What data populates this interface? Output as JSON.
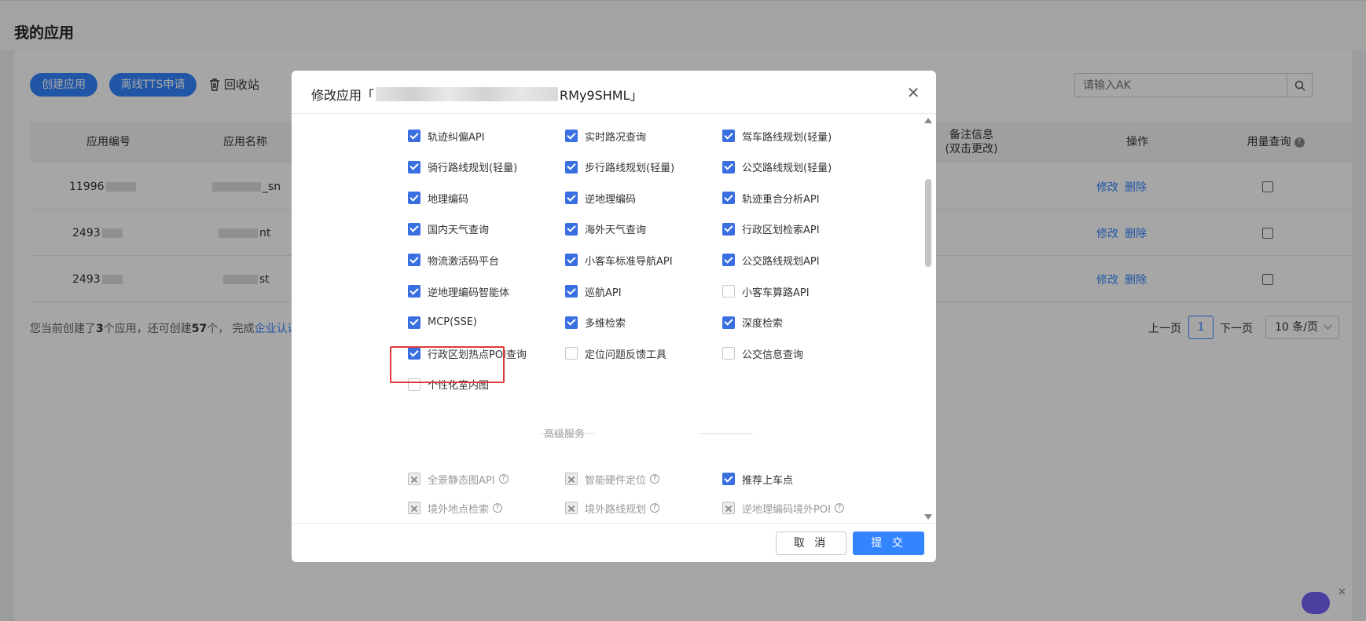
{
  "page": {
    "title": "我的应用"
  },
  "toolbar": {
    "create_label": "创建应用",
    "tts_label": "离线TTS申请",
    "recycle_label": "回收站"
  },
  "search": {
    "placeholder": "请输入AK"
  },
  "table": {
    "headers": {
      "id": "应用编号",
      "name": "应用名称",
      "remark_line1": "备注信息",
      "remark_line2": "(双击更改)",
      "actions": "操作",
      "usage": "用量查询"
    },
    "rows": [
      {
        "id": "11996",
        "name": "_sn",
        "edit": "修改",
        "delete": "删除"
      },
      {
        "id": "2493",
        "name": "nt",
        "edit": "修改",
        "delete": "删除"
      },
      {
        "id": "2493",
        "name": "st",
        "edit": "修改",
        "delete": "删除"
      }
    ]
  },
  "footer": {
    "prefix": "您当前创建了",
    "created": "3",
    "middle": "个应用，还可创建",
    "remaining": "57",
    "suffix": "个，  完成",
    "link": "企业认证"
  },
  "pagination": {
    "prev": "上一页",
    "current": "1",
    "next": "下一页",
    "page_size": "10 条/页"
  },
  "modal": {
    "title_prefix": "修改应用「",
    "title_visible_key": "RMy9SHML」",
    "cancel_label": "取 消",
    "submit_label": "提 交",
    "section_advanced": "高级服务",
    "services": [
      {
        "label": "轨迹纠偏API",
        "state": "checked"
      },
      {
        "label": "实时路况查询",
        "state": "checked"
      },
      {
        "label": "驾车路线规划(轻量)",
        "state": "checked"
      },
      {
        "label": "骑行路线规划(轻量)",
        "state": "checked"
      },
      {
        "label": "步行路线规划(轻量)",
        "state": "checked"
      },
      {
        "label": "公交路线规划(轻量)",
        "state": "checked"
      },
      {
        "label": "地理编码",
        "state": "checked"
      },
      {
        "label": "逆地理编码",
        "state": "checked"
      },
      {
        "label": "轨迹重合分析API",
        "state": "checked"
      },
      {
        "label": "国内天气查询",
        "state": "checked"
      },
      {
        "label": "海外天气查询",
        "state": "checked"
      },
      {
        "label": "行政区划检索API",
        "state": "checked"
      },
      {
        "label": "物流激活码平台",
        "state": "checked"
      },
      {
        "label": "小客车标准导航API",
        "state": "checked"
      },
      {
        "label": "公交路线规划API",
        "state": "checked"
      },
      {
        "label": "逆地理编码智能体",
        "state": "checked"
      },
      {
        "label": "巡航API",
        "state": "checked"
      },
      {
        "label": "小客车算路API",
        "state": "unchecked"
      },
      {
        "label": "MCP(SSE)",
        "state": "checked"
      },
      {
        "label": "多维检索",
        "state": "checked"
      },
      {
        "label": "深度检索",
        "state": "checked"
      },
      {
        "label": "行政区划热点POI查询",
        "state": "checked"
      },
      {
        "label": "定位问题反馈工具",
        "state": "unchecked"
      },
      {
        "label": "公交信息查询",
        "state": "unchecked"
      },
      {
        "label": "个性化室内图",
        "state": "unchecked"
      }
    ],
    "advanced": [
      {
        "label": "全景静态图API",
        "state": "disabled",
        "help": "?"
      },
      {
        "label": "智能硬件定位",
        "state": "disabled",
        "help": "?"
      },
      {
        "label": "推荐上车点",
        "state": "checked",
        "help": ""
      },
      {
        "label": "境外地点检索",
        "state": "disabled",
        "help": "?"
      },
      {
        "label": "境外路线规划",
        "state": "disabled",
        "help": "?"
      },
      {
        "label": "逆地理编码境外POI",
        "state": "disabled",
        "help": "?"
      }
    ]
  },
  "colors": {
    "accent": "#3385ff",
    "checkbox": "#3a6fe2",
    "highlight": "#e03a3a"
  }
}
